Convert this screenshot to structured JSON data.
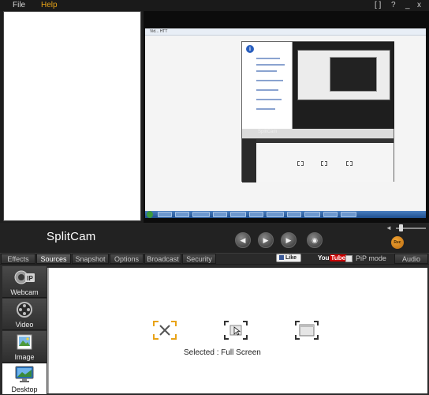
{
  "menu": {
    "file": "File",
    "help": "Help"
  },
  "window_controls": {
    "fullscreen": "[ ]",
    "help": "?",
    "minimize": "_",
    "close": "x"
  },
  "app": {
    "logo": "SplitCam"
  },
  "preview": {
    "desktop_title": "Vid... HTT",
    "dialog_info_icon": "i",
    "nested_logo": "SplitCam"
  },
  "controls": {
    "prev_symbol": "◀",
    "play_symbol": "▶",
    "next_symbol": "▶",
    "snapshot_symbol": "◉",
    "rec_label": "Rec",
    "volume_symbol": "◄"
  },
  "tabs": [
    {
      "label": "Effects",
      "active": false
    },
    {
      "label": "Sources",
      "active": true
    },
    {
      "label": "Snapshot",
      "active": false
    },
    {
      "label": "Options",
      "active": false
    },
    {
      "label": "Broadcast",
      "active": false
    },
    {
      "label": "Security",
      "active": false
    },
    {
      "label": "Audio",
      "active": false
    }
  ],
  "social": {
    "like": "Like",
    "youtube_you": "You",
    "youtube_tube": "Tube"
  },
  "pip": {
    "label": "PiP mode",
    "checked": false
  },
  "sources": [
    {
      "label": "Webcam",
      "icon": "webcam-ip-icon",
      "active": false
    },
    {
      "label": "Video",
      "icon": "film-reel-icon",
      "active": false
    },
    {
      "label": "Image",
      "icon": "picture-icon",
      "active": false
    },
    {
      "label": "Desktop",
      "icon": "monitor-icon",
      "active": true
    }
  ],
  "desktop_modes": [
    {
      "name": "full-screen",
      "icon": "full-screen-icon",
      "selected": true
    },
    {
      "name": "selection",
      "icon": "cursor-select-icon",
      "selected": false
    },
    {
      "name": "window",
      "icon": "window-capture-icon",
      "selected": false
    }
  ],
  "selected_text": "Selected : Full Screen",
  "colors": {
    "accent": "#e8a317",
    "background": "#1e1e1e",
    "tab": "#3c3c3c",
    "panel": "#ffffff"
  }
}
